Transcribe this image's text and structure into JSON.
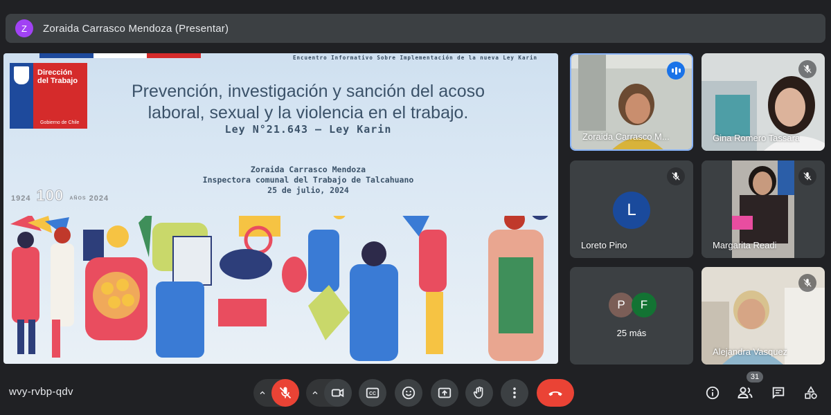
{
  "presenter_bar": {
    "avatar_letter": "Z",
    "title": "Zoraida Carrasco Mendoza (Presentar)"
  },
  "slide": {
    "header": "Encuentro Informativo Sobre Implementación de la nueva Ley Karin",
    "logo_text_line1": "Dirección",
    "logo_text_line2": "del Trabajo",
    "logo_gobierno": "Gobierno de Chile",
    "year_start": "1924",
    "year_center": "100",
    "year_label": "AÑOS",
    "year_end": "2024",
    "title_line1": "Prevención, investigación y sanción del acoso",
    "title_line2": "laboral, sexual y la violencia en el trabajo.",
    "subtitle": "Ley N°21.643 – Ley Karin",
    "presenter_name": "Zoraida Carrasco Mendoza",
    "presenter_role": "Inspectora comunal del Trabajo de Talcahuano",
    "date": "25 de julio, 2024"
  },
  "participants": {
    "tile1_name": "Zoraida Carrasco M...",
    "tile2_name": "Gina Romero Tassara",
    "tile3_name": "Loreto Pino",
    "tile3_avatar": "L",
    "tile4_name": "Margarita Readi",
    "tile5_avatar1": "P",
    "tile5_avatar2": "F",
    "tile5_more": "25 más",
    "tile6_name": "Alejandra Vasquez"
  },
  "bottom_bar": {
    "meeting_code": "wvy-rvbp-qdv",
    "people_count": "31"
  },
  "colors": {
    "background": "#202124",
    "tile": "#3c4043",
    "active_border": "#8ab4f8",
    "end_call": "#ea4335",
    "mic_off": "#ea4335",
    "loreto_avatar": "#1a4a9c",
    "p_avatar": "#7b5e57",
    "f_avatar": "#137333"
  },
  "icons": [
    "microphone-off-icon",
    "camera-icon",
    "captions-icon",
    "emoji-icon",
    "present-screen-icon",
    "raise-hand-icon",
    "more-options-icon",
    "end-call-icon",
    "info-icon",
    "people-icon",
    "chat-icon",
    "activities-icon"
  ]
}
